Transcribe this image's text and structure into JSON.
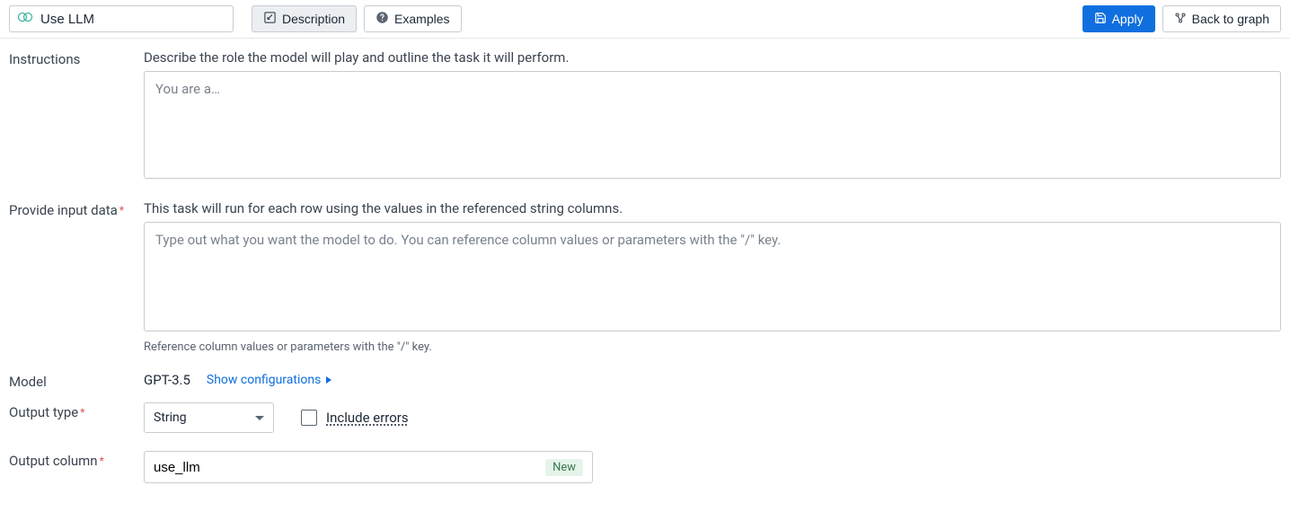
{
  "title": "Use LLM",
  "toolbar": {
    "description": "Description",
    "examples": "Examples",
    "apply": "Apply",
    "back": "Back to graph"
  },
  "form": {
    "instructions": {
      "label": "Instructions",
      "helper": "Describe the role the model will play and outline the task it will perform.",
      "placeholder": "You are a…"
    },
    "input_data": {
      "label": "Provide input data",
      "helper": "This task will run for each row using the values in the referenced string columns.",
      "placeholder": "Type out what you want the model to do. You can reference column values or parameters with the \"/\" key.",
      "hint": "Reference column values or parameters with the \"/\" key."
    },
    "model": {
      "label": "Model",
      "value": "GPT-3.5",
      "config_link": "Show configurations"
    },
    "output_type": {
      "label": "Output type",
      "value": "String",
      "include_errors": "Include errors"
    },
    "output_column": {
      "label": "Output column",
      "value": "use_llm",
      "badge": "New"
    }
  }
}
